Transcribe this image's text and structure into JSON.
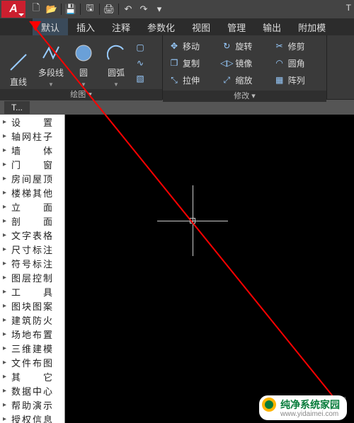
{
  "app": {
    "logo_letter": "A",
    "open_doc": "T"
  },
  "qat": [
    "new",
    "open",
    "save",
    "saveas",
    "print",
    "undo",
    "redo"
  ],
  "tabs": [
    {
      "id": "default",
      "label": "默认",
      "active": true
    },
    {
      "id": "insert",
      "label": "插入"
    },
    {
      "id": "annotate",
      "label": "注释"
    },
    {
      "id": "param",
      "label": "参数化"
    },
    {
      "id": "view",
      "label": "视图"
    },
    {
      "id": "manage",
      "label": "管理"
    },
    {
      "id": "output",
      "label": "输出"
    },
    {
      "id": "addon",
      "label": "附加模"
    }
  ],
  "draw_panel": {
    "title": "绘图",
    "tools": [
      {
        "id": "line",
        "label": "直线"
      },
      {
        "id": "pline",
        "label": "多段线"
      },
      {
        "id": "circle",
        "label": "圆"
      },
      {
        "id": "arc",
        "label": "圆弧"
      }
    ]
  },
  "modify_panel": {
    "title": "修改",
    "tools": [
      {
        "id": "move",
        "label": "移动"
      },
      {
        "id": "rotate",
        "label": "旋转"
      },
      {
        "id": "trim",
        "label": "修剪"
      },
      {
        "id": "copy",
        "label": "复制"
      },
      {
        "id": "mirror",
        "label": "镜像"
      },
      {
        "id": "fillet",
        "label": "圆角"
      },
      {
        "id": "stretch",
        "label": "拉伸"
      },
      {
        "id": "scale",
        "label": "缩放"
      },
      {
        "id": "array",
        "label": "阵列"
      }
    ]
  },
  "doc_tab_label": "T...",
  "sidebar": {
    "items": [
      "设　　置",
      "轴网柱子",
      "墙　　体",
      "门　　窗",
      "房间屋顶",
      "楼梯其他",
      "立　　面",
      "剖　　面",
      "文字表格",
      "尺寸标注",
      "符号标注",
      "图层控制",
      "工　　具",
      "图块图案",
      "建筑防火",
      "场地布置",
      "三维建模",
      "文件布图",
      "其　　它",
      "数据中心",
      "帮助演示",
      "授权信息"
    ]
  },
  "watermark": "www.yidaimei.com",
  "badge": {
    "name": "纯净系统家园",
    "url": "www.yidaimei.com"
  }
}
